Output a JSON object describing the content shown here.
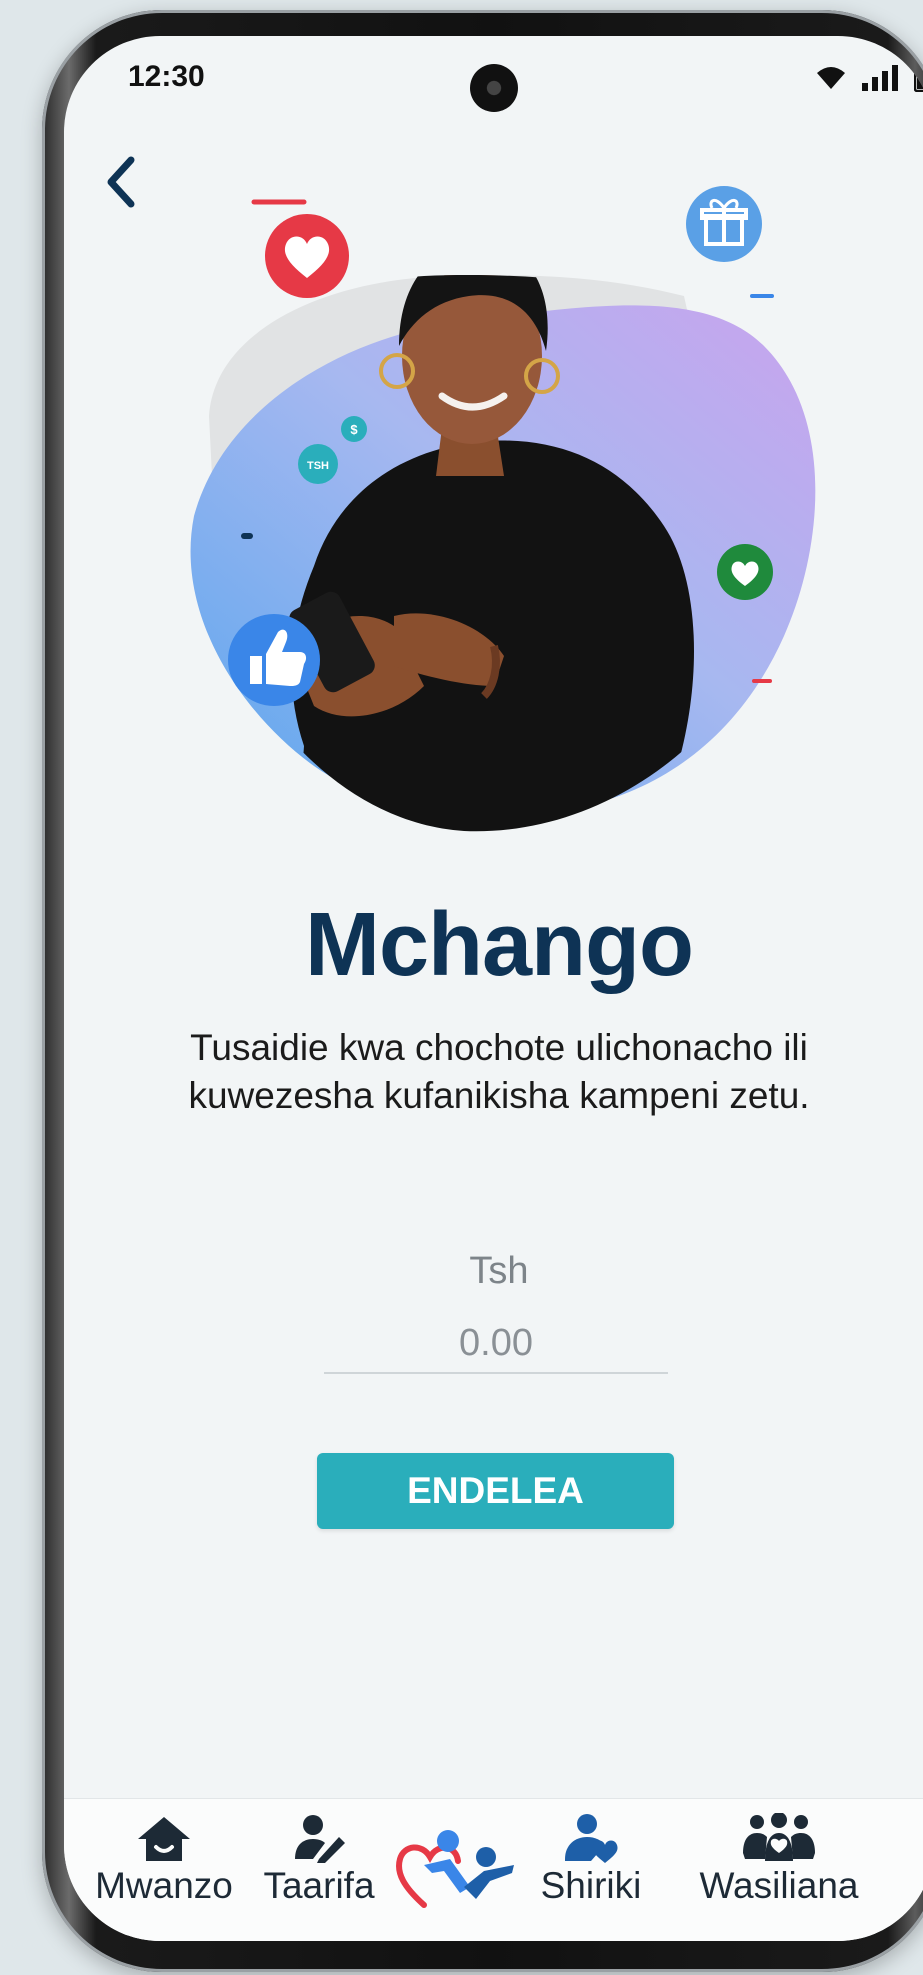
{
  "status_bar": {
    "time": "12:30"
  },
  "header": {
    "back_icon": "chevron-left-icon"
  },
  "main": {
    "title": "Mchango",
    "subtitle": "Tusaidie kwa chochote ulichonacho ili kuwezesha kufanikisha kampeni zetu.",
    "currency_label": "Tsh",
    "amount_placeholder": "0.00",
    "continue_label": "ENDELEA"
  },
  "hero_badges": {
    "coin_label": "TSH",
    "dollar_label": "$"
  },
  "bottom_nav": {
    "items": [
      {
        "label": "Mwanzo",
        "icon": "home-icon"
      },
      {
        "label": "Taarifa",
        "icon": "user-edit-icon"
      },
      {
        "label": "",
        "icon": "brand-logo-icon"
      },
      {
        "label": "Shiriki",
        "icon": "user-heart-icon"
      },
      {
        "label": "Wasiliana",
        "icon": "group-icon"
      }
    ]
  },
  "colors": {
    "title": "#0e3355",
    "accent": "#2aaebb",
    "heart_red": "#e63946",
    "like_blue": "#3a86e8",
    "gift_blue": "#5aa0e6",
    "heart_green": "#1f8a3c"
  }
}
